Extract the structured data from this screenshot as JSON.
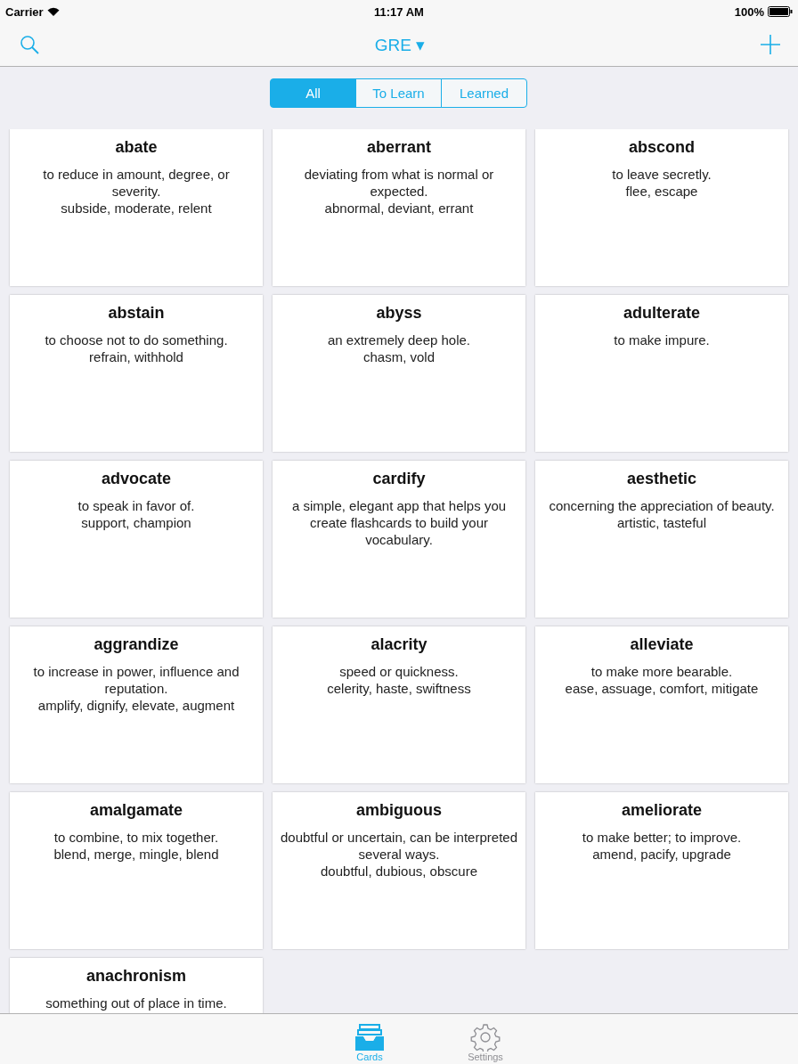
{
  "status_bar": {
    "carrier": "Carrier",
    "time": "11:17 AM",
    "battery": "100%"
  },
  "nav": {
    "title": "GRE ▾"
  },
  "segments": [
    {
      "label": "All",
      "selected": true
    },
    {
      "label": "To Learn",
      "selected": false
    },
    {
      "label": "Learned",
      "selected": false
    }
  ],
  "cards": [
    {
      "word": "abate",
      "lines": [
        "to reduce in amount, degree, or severity.",
        "subside, moderate, relent"
      ]
    },
    {
      "word": "aberrant",
      "lines": [
        "deviating from what is normal or expected.",
        "abnormal, deviant, errant"
      ]
    },
    {
      "word": "abscond",
      "lines": [
        "to leave secretly.",
        "flee, escape"
      ]
    },
    {
      "word": "abstain",
      "lines": [
        "to choose not to do something.",
        "refrain, withhold"
      ]
    },
    {
      "word": "abyss",
      "lines": [
        "an extremely deep hole.",
        "chasm, vold"
      ]
    },
    {
      "word": "adulterate",
      "lines": [
        "to make impure."
      ]
    },
    {
      "word": "advocate",
      "lines": [
        "to speak in favor of.",
        "support, champion"
      ]
    },
    {
      "word": "cardify",
      "lines": [
        "a simple, elegant app that helps you create flashcards to build your vocabulary."
      ]
    },
    {
      "word": "aesthetic",
      "lines": [
        "concerning the appreciation of beauty.",
        "artistic, tasteful"
      ]
    },
    {
      "word": "aggrandize",
      "lines": [
        "to increase in power, influence and reputation.",
        "amplify, dignify, elevate, augment"
      ]
    },
    {
      "word": "alacrity",
      "lines": [
        "speed or quickness.",
        "celerity, haste, swiftness"
      ]
    },
    {
      "word": "alleviate",
      "lines": [
        "to make more bearable.",
        "ease, assuage, comfort, mitigate"
      ]
    },
    {
      "word": "amalgamate",
      "lines": [
        "to combine, to mix together.",
        "blend, merge, mingle, blend"
      ]
    },
    {
      "word": "ambiguous",
      "lines": [
        "doubtful or uncertain, can be interpreted several ways.",
        "doubtful, dubious, obscure"
      ]
    },
    {
      "word": "ameliorate",
      "lines": [
        "to make better; to improve.",
        "amend, pacify, upgrade"
      ]
    },
    {
      "word": "anachronism",
      "lines": [
        "something out of place in time."
      ]
    }
  ],
  "tab_bar": [
    {
      "label": "Cards",
      "kind": "cards",
      "selected": true
    },
    {
      "label": "Settings",
      "kind": "settings",
      "selected": false
    }
  ]
}
